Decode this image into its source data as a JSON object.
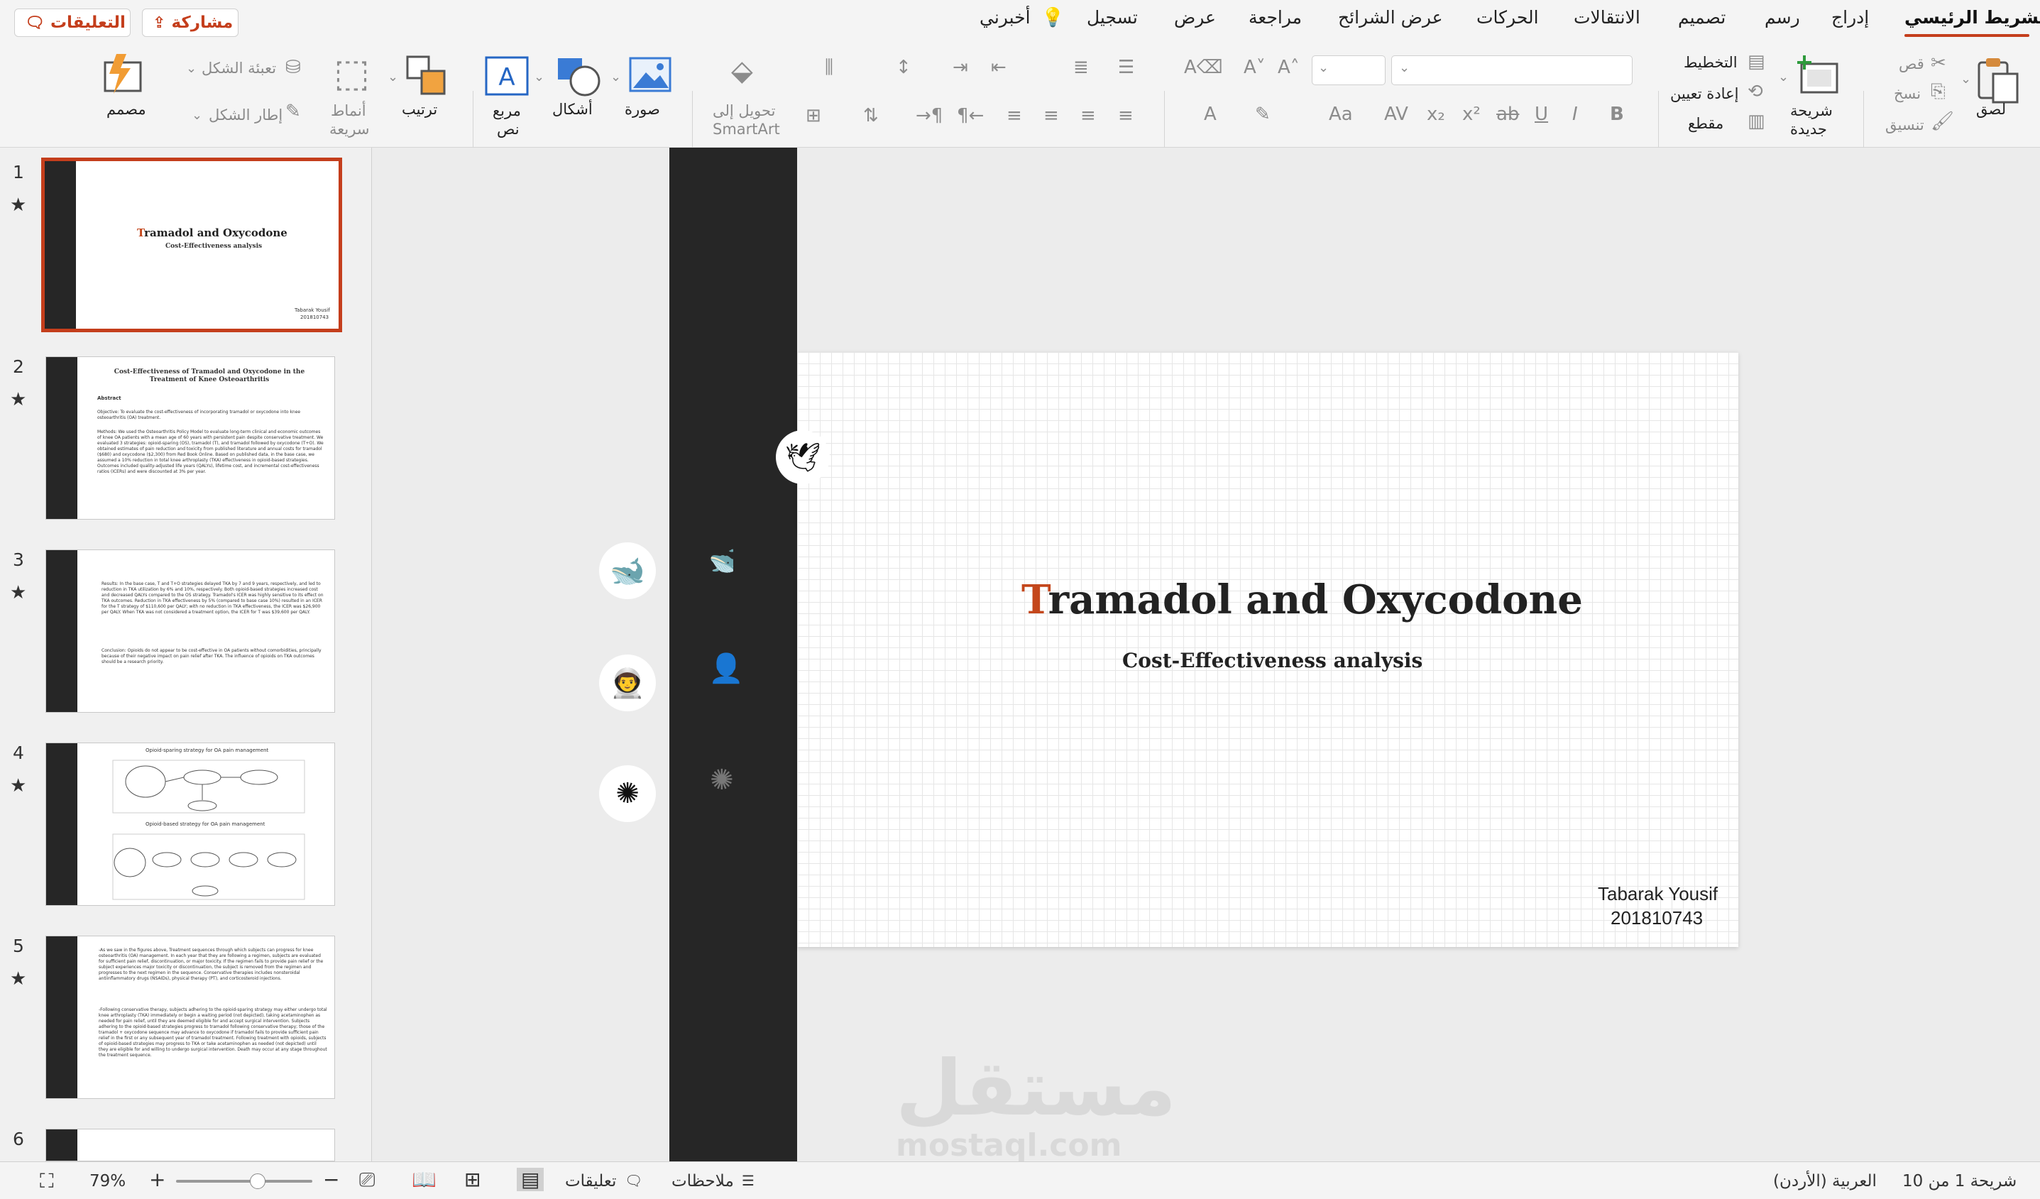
{
  "topbar": {
    "comments_button": "التعليقات",
    "share_button": "مشاركة",
    "tabs": [
      "الشريط الرئيسي",
      "إدراج",
      "رسم",
      "تصميم",
      "الانتقالات",
      "الحركات",
      "عرض الشرائح",
      "مراجعة",
      "عرض",
      "تسجيل",
      "أخبرني"
    ]
  },
  "ribbon": {
    "paste": "لصق",
    "cut": "قص",
    "copy": "نسخ",
    "format": "تنسيق",
    "new_slide_1": "شريحة",
    "new_slide_2": "جديدة",
    "layout": "التخطيط",
    "reset": "إعادة تعيين",
    "section": "مقطع",
    "convert_smartart_1": "تحويل إلى",
    "convert_smartart_2": "SmartArt",
    "picture": "صورة",
    "shapes": "أشكال",
    "textbox_1": "مربع",
    "textbox_2": "نص",
    "arrange": "ترتيب",
    "quick_styles_1": "أنماط",
    "quick_styles_2": "سريعة",
    "shape_fill": "تعبئة الشكل",
    "shape_outline": "إطار الشكل",
    "designer": "مصمم"
  },
  "thumbnails": [
    {
      "num": "1",
      "title_first": "T",
      "title_rest": "ramadol and Oxycodone",
      "subtitle": "Cost-Effectiveness analysis",
      "author": "Tabarak Yousif",
      "id": "201810743"
    },
    {
      "num": "2",
      "title": "Cost-Effectiveness of Tramadol and Oxycodone in the Treatment of Knee Osteoarthritis",
      "abstract": "Abstract",
      "objective": "Objective: To evaluate the cost-effectiveness of incorporating tramadol or oxycodone into knee osteoarthritis (OA) treatment.",
      "methods": "Methods: We used the Osteoarthritis Policy Model to evaluate long-term clinical and economic outcomes of knee OA patients with a mean age of 60 years with persistent pain despite conservative treatment. We evaluated 3 strategies: opioid-sparing (OS), tramadol (T), and tramadol followed by oxycodone (T+O). We obtained estimates of pain reduction and toxicity from published literature and annual costs for tramadol ($680) and oxycodone ($2,300) from Red Book Online. Based on published data, in the base case, we assumed a 10% reduction in total knee arthroplasty (TKA) effectiveness in opioid-based strategies. Outcomes included quality-adjusted life years (QALYs), lifetime cost, and incremental cost-effectiveness ratios (ICERs) and were discounted at 3% per year."
    },
    {
      "num": "3",
      "results": "Results: In the base case, T and T+O strategies delayed TKA by 7 and 9 years, respectively, and led to reduction in TKA utilization by 6% and 10%, respectively. Both opioid-based strategies increased cost and decreased QALYs compared to the OS strategy. Tramadol's ICER was highly sensitive to its effect on TKA outcomes. Reduction in TKA effectiveness by 5% (compared to base case 10%) resulted in an ICER for the T strategy of $110,600 per QALY; with no reduction in TKA effectiveness, the ICER was $26,900 per QALY. When TKA was not considered a treatment option, the ICER for T was $39,600 per QALY.",
      "conclusion": "Conclusion: Opioids do not appear to be cost-effective in OA patients without comorbidities, principally because of their negative impact on pain relief after TKA. The influence of opioids on TKA outcomes should be a research priority."
    },
    {
      "num": "4",
      "diagram1": "Opioid-sparing strategy for OA pain management",
      "diagram2": "Opioid-based strategy for OA pain management"
    },
    {
      "num": "5",
      "para1": "-As we saw in the figures above, Treatment sequences through which subjects can progress for knee osteoarthritis (OA) management. In each year that they are following a regimen, subjects are evaluated for sufficient pain relief, discontinuation, or major toxicity. If the regimen fails to provide pain relief or the subject experiences major toxicity or discontinuation, the subject is removed from the regimen and progresses to the next regimen in the sequence. Conservative therapies includes nonsteroidal antiinflammatory drugs (NSAIDs), physical therapy (PT), and corticosteroid injections.",
      "para2": "-Following conservative therapy, subjects adhering to the opioid-sparing strategy may either undergo total knee arthroplasty (TKA) immediately or begin a waiting period (not depicted), taking acetaminophen as needed for pain relief, until they are deemed eligible for and accept surgical intervention. Subjects adhering to the opioid-based strategies progress to tramadol following conservative therapy; those of the tramadol + oxycodone sequence may advance to oxycodone if tramadol fails to provide sufficient pain relief in the first or any subsequent year of tramadol treatment. Following treatment with opioids, subjects of opioid-based strategies may progress to TKA or take acetaminophen as needed (not depicted) until they are eligible for and willing to undergo surgical intervention. Death may occur at any stage throughout the treatment sequence."
    },
    {
      "num": "6"
    }
  ],
  "slide": {
    "title_first": "T",
    "title_rest": "ramadol and Oxycodone",
    "subtitle": "Cost-Effectiveness analysis",
    "author": "Tabarak Yousif",
    "id": "201810743",
    "accent": "#c4471c"
  },
  "status": {
    "slide_of": "شريحة 1 من 10",
    "language": "العربية (الأردن)",
    "notes": "ملاحظات",
    "comments": "تعليقات",
    "zoom": "79%"
  },
  "watermark": {
    "arabic": "مستقل",
    "latin": "mostaql.com"
  }
}
